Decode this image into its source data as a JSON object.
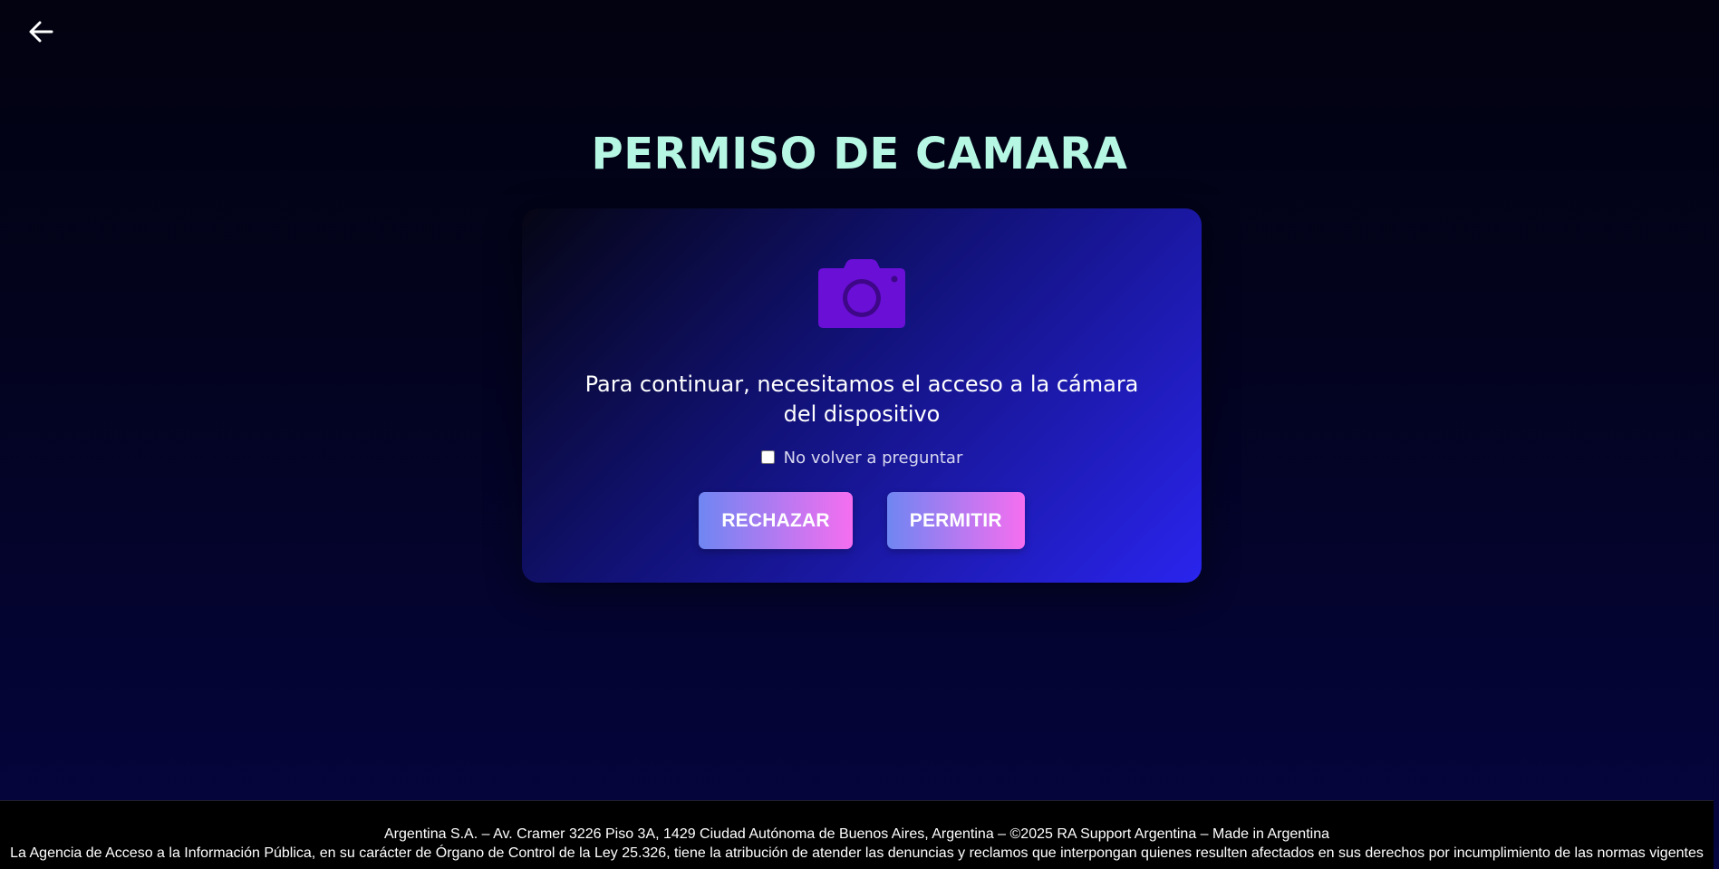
{
  "header": {
    "back_icon": "arrow-left-icon"
  },
  "page": {
    "title": "PERMISO DE CAMARA"
  },
  "card": {
    "icon": "camera-icon",
    "message": "Para continuar, necesitamos el acceso a la cámara del dispositivo",
    "checkbox_label": "No volver a preguntar",
    "checkbox_checked": false,
    "reject_label": "RECHAZAR",
    "allow_label": "PERMITIR"
  },
  "footer": {
    "line1": "Argentina S.A. – Av. Cramer 3226 Piso 3A, 1429 Ciudad Autónoma de Buenos Aires, Argentina – ©2025 RA Support Argentina – Made in Argentina",
    "line2": "La Agencia de Acceso a la Información Pública, en su carácter de Órgano de Control de la Ley 25.326, tiene la atribución de atender las denuncias y reclamos que interpongan quienes resulten afectados en sus derechos por incumplimiento de las normas vigentes"
  },
  "colors": {
    "title": "#b6f7e3",
    "camera": "#6a0fd6",
    "button_gradient_start": "#6f86f2",
    "button_gradient_end": "#f56ef0",
    "card_gradient_end": "#2a24ee"
  }
}
